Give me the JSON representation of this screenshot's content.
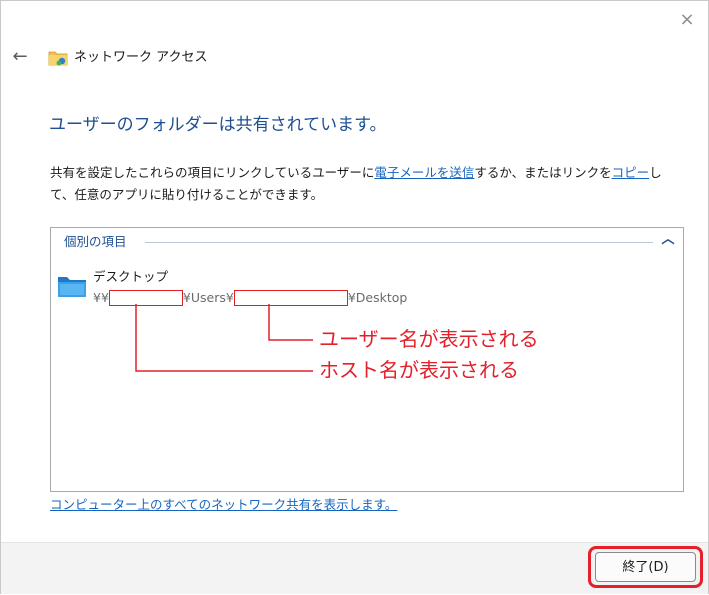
{
  "window": {
    "title": "ネットワーク アクセス",
    "close_glyph": "×",
    "back_glyph": "←"
  },
  "heading": "ユーザーのフォルダーは共有されています。",
  "description": {
    "part1": "共有を設定したこれらの項目にリンクしているユーザーに",
    "email_link": "電子メールを送信",
    "part2": "するか、またはリンクを",
    "copy_link": "コピー",
    "part3": "して、任意のアプリに貼り付けることができます。"
  },
  "group": {
    "header": "個別の項目",
    "chevron_glyph": "︿",
    "item": {
      "name": "デスクトップ",
      "path_prefix": "¥¥",
      "path_middle": "¥Users¥",
      "path_suffix": "¥Desktop"
    }
  },
  "annotations": {
    "user_label": "ユーザー名が表示される",
    "host_label": "ホスト名が表示される",
    "color": "#e4202a"
  },
  "bottom_link": "コンピューター上のすべてのネットワーク共有を表示します。",
  "footer": {
    "finish_label": "終了(D)"
  },
  "icons": {
    "title": "network-folder-icon",
    "item": "folder-desktop-icon"
  }
}
